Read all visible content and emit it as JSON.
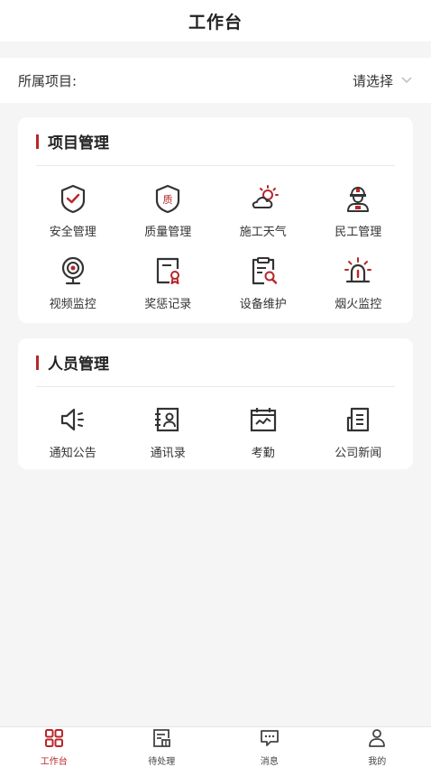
{
  "header": {
    "title": "工作台"
  },
  "project": {
    "label": "所属项目:",
    "placeholder": "请选择",
    "icon": "chevron-down-icon"
  },
  "sections": [
    {
      "title": "项目管理",
      "items": [
        {
          "label": "安全管理",
          "icon": "shield-check-icon"
        },
        {
          "label": "质量管理",
          "icon": "quality-shield-icon"
        },
        {
          "label": "施工天气",
          "icon": "weather-icon"
        },
        {
          "label": "民工管理",
          "icon": "worker-icon"
        },
        {
          "label": "视频监控",
          "icon": "camera-icon"
        },
        {
          "label": "奖惩记录",
          "icon": "award-record-icon"
        },
        {
          "label": "设备维护",
          "icon": "device-maintenance-icon"
        },
        {
          "label": "烟火监控",
          "icon": "alarm-light-icon"
        }
      ]
    },
    {
      "title": "人员管理",
      "items": [
        {
          "label": "通知公告",
          "icon": "speaker-icon"
        },
        {
          "label": "通讯录",
          "icon": "contacts-icon"
        },
        {
          "label": "考勤",
          "icon": "attendance-icon"
        },
        {
          "label": "公司新闻",
          "icon": "news-icon"
        }
      ]
    }
  ],
  "tabbar": [
    {
      "label": "工作台",
      "icon": "grid-icon",
      "active": true
    },
    {
      "label": "待处理",
      "icon": "todo-icon",
      "active": false
    },
    {
      "label": "消息",
      "icon": "message-icon",
      "active": false
    },
    {
      "label": "我的",
      "icon": "profile-icon",
      "active": false
    }
  ],
  "colors": {
    "accent": "#b8262a",
    "background": "#f5f5f5",
    "card": "#ffffff",
    "text": "#333333"
  }
}
